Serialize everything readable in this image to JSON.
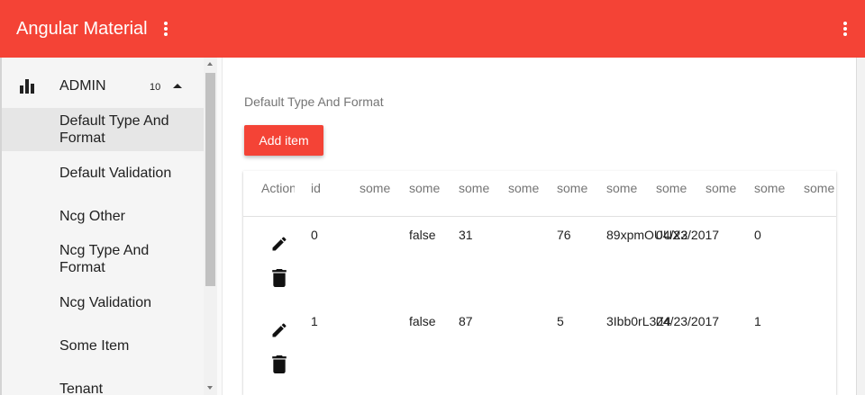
{
  "toolbar": {
    "title": "Angular Material",
    "left_menu_icon": "more-vert-icon",
    "right_menu_icon": "more-vert-icon",
    "color": "#f44336"
  },
  "sidebar": {
    "group": {
      "icon": "bar-chart-icon",
      "label": "ADMIN",
      "count": "10",
      "expanded": true
    },
    "items": [
      {
        "label": "Default Type And Format",
        "active": true
      },
      {
        "label": "Default Validation",
        "active": false
      },
      {
        "label": "Ncg Other",
        "active": false
      },
      {
        "label": "Ncg Type And Format",
        "active": false
      },
      {
        "label": "Ncg Validation",
        "active": false
      },
      {
        "label": "Some Item",
        "active": false
      },
      {
        "label": "Tenant",
        "active": false
      }
    ]
  },
  "main": {
    "section_title": "Default Type And Format",
    "add_button": "Add item",
    "table": {
      "columns": [
        "Actions",
        "id",
        "some",
        "some",
        "some",
        "some",
        "some",
        "some",
        "some",
        "some",
        "some",
        "some"
      ],
      "rows": [
        {
          "cells": [
            "0",
            "",
            "false",
            "31",
            "",
            "76",
            "89xpmOUUX2",
            "04/23/2017",
            "",
            "0",
            ""
          ],
          "edit_icon": "pencil-icon",
          "delete_icon": "trash-icon"
        },
        {
          "cells": [
            "1",
            "",
            "false",
            "87",
            "",
            "5",
            "3Ibb0rL3Z4",
            "04/23/2017",
            "",
            "1",
            ""
          ],
          "edit_icon": "pencil-icon",
          "delete_icon": "trash-icon"
        }
      ]
    }
  }
}
